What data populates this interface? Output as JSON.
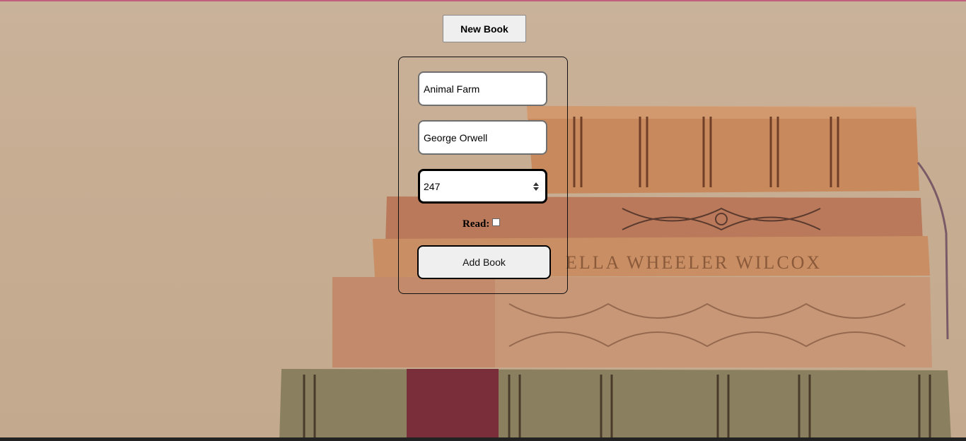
{
  "header": {
    "new_book_label": "New Book"
  },
  "form": {
    "title_value": "Animal Farm",
    "author_value": "George Orwell",
    "pages_value": "247",
    "read_label": "Read:",
    "read_checked": false,
    "submit_label": "Add Book"
  },
  "colors": {
    "background": "#c9b29a",
    "accent_line": "#c0607e",
    "button_bg": "#efefef"
  }
}
